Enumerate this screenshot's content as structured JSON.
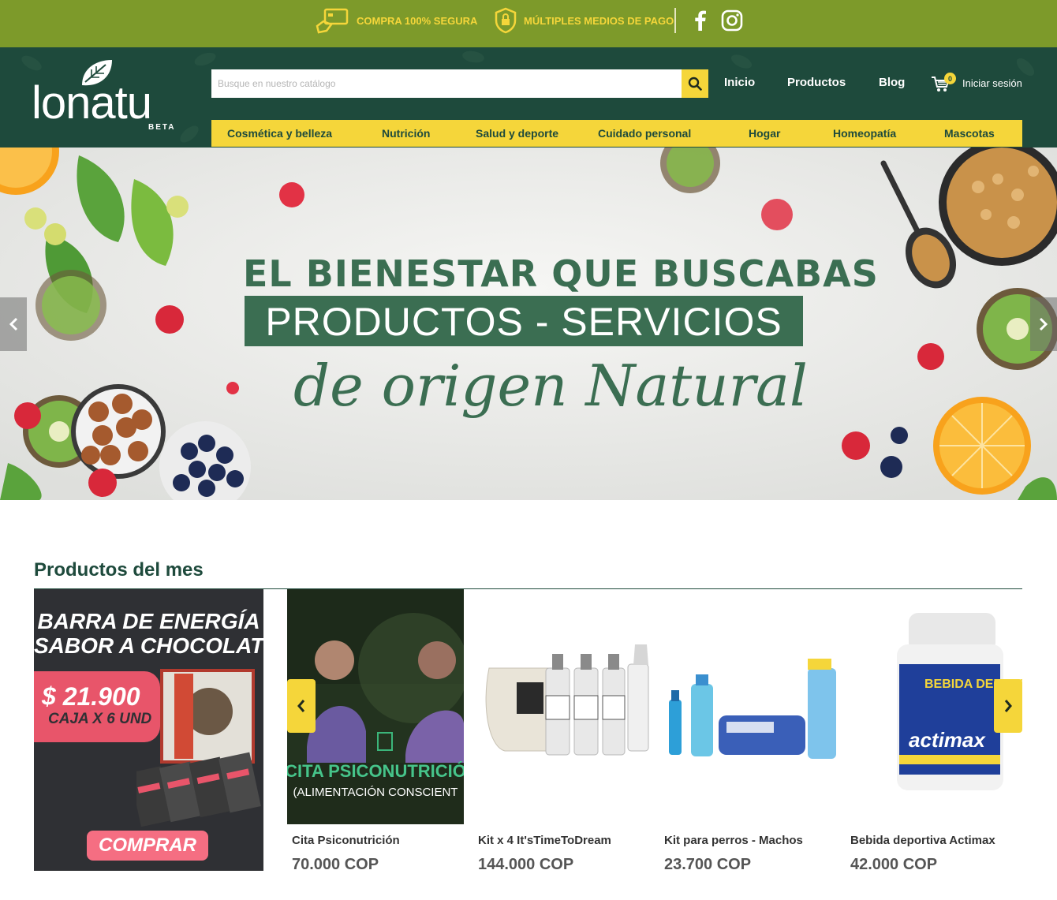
{
  "topbar": {
    "secure_label": "COMPRA 100% SEGURA",
    "payment_label": "MÚLTIPLES MEDIOS DE PAGO",
    "social": [
      "facebook-icon",
      "instagram-icon"
    ],
    "colors": {
      "background": "#7d9a2a",
      "text": "#f5d63a"
    }
  },
  "header": {
    "logo_text": "lonatu",
    "logo_beta": "BETA",
    "search_placeholder": "Busque en nuestro catálogo",
    "nav": {
      "inicio": "Inicio",
      "productos": "Productos",
      "blog": "Blog"
    },
    "cart_count": "0",
    "login_label": "Iniciar sesión",
    "colors": {
      "background": "#1e4a3c",
      "accent": "#f5d63a"
    }
  },
  "categories": [
    "Cosmética y belleza",
    "Nutrición",
    "Salud y deporte",
    "Cuidado personal",
    "Hogar",
    "Homeopatía",
    "Mascotas"
  ],
  "hero": {
    "line1": "EL BIENESTAR QUE BUSCABAS",
    "line2": "PRODUCTOS - SERVICIOS",
    "line3": "de origen Natural",
    "color": "#3b6e52"
  },
  "products_section": {
    "title": "Productos del mes",
    "promo": {
      "title_line1": "BARRA DE ENERGÍA",
      "title_line2": "SABOR A CHOCOLATE",
      "price": "$ 21.900",
      "unit": "CAJA X 6 UND",
      "button": "COMPRAR"
    },
    "items": [
      {
        "name": "Cita Psiconutrición",
        "price": "70.000 COP",
        "image_text_1": "CITA PSICONUTRICIÓ",
        "image_text_2": "(ALIMENTACIÓN CONSCIENT"
      },
      {
        "name": "Kit x 4 It'sTimeToDream",
        "price": "144.000 COP"
      },
      {
        "name": "Kit para perros - Machos",
        "price": "23.700 COP"
      },
      {
        "name": "Bebida deportiva Actimax",
        "price": "42.000 COP",
        "image_text_1": "BEBIDA DEPORTIVA",
        "image_text_2": "actimax"
      }
    ]
  }
}
